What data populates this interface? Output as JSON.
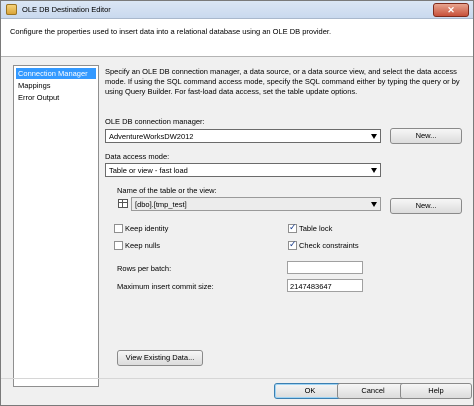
{
  "window": {
    "title": "OLE DB Destination Editor",
    "close_glyph": "✕"
  },
  "header": {
    "description": "Configure the properties used to insert data into a relational database using an OLE DB provider."
  },
  "nav": {
    "items": [
      {
        "label": "Connection Manager",
        "selected": true
      },
      {
        "label": "Mappings"
      },
      {
        "label": "Error Output"
      }
    ]
  },
  "panel": {
    "description": "Specify an OLE DB connection manager, a data source, or a data source view, and select the data access mode. If using the SQL command access mode, specify the SQL command either by typing the query or by using Query Builder. For fast-load data access, set the table update options.",
    "connection_label": "OLE DB connection manager:",
    "connection_value": "AdventureWorksDW2012",
    "new_button_1": "New...",
    "access_mode_label": "Data access mode:",
    "access_mode_value": "Table or view - fast load",
    "table_label": "Name of the table or the view:",
    "table_value": "[dbo].[tmp_test]",
    "new_button_2": "New...",
    "keep_identity": {
      "label": "Keep identity",
      "checked": false
    },
    "table_lock": {
      "label": "Table lock",
      "checked": true
    },
    "keep_nulls": {
      "label": "Keep nulls",
      "checked": false
    },
    "check_constraints": {
      "label": "Check constraints",
      "checked": true
    },
    "rows_per_batch_label": "Rows per batch:",
    "rows_per_batch_value": "",
    "max_commit_label": "Maximum insert commit size:",
    "max_commit_value": "2147483647",
    "view_data_button": "View Existing Data..."
  },
  "footer": {
    "ok": "OK",
    "cancel": "Cancel",
    "help": "Help"
  },
  "icons": {
    "dropdown": "chevron-down-icon",
    "checkmark": "✓"
  },
  "colors": {
    "selection": "#3399ff",
    "titlebar": "#c9d9ee",
    "close": "#c7503a"
  }
}
